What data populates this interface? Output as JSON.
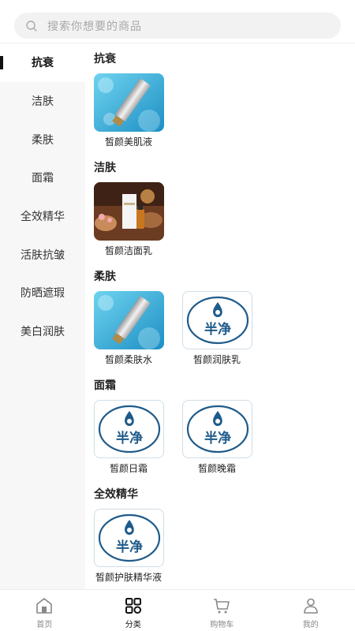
{
  "search": {
    "placeholder": "搜索你想要的商品"
  },
  "sidebar": {
    "items": [
      {
        "label": "抗衰",
        "active": true
      },
      {
        "label": "洁肤",
        "active": false
      },
      {
        "label": "柔肤",
        "active": false
      },
      {
        "label": "面霜",
        "active": false
      },
      {
        "label": "全效精华",
        "active": false
      },
      {
        "label": "活肤抗皱",
        "active": false
      },
      {
        "label": "防晒遮瑕",
        "active": false
      },
      {
        "label": "美白润肤",
        "active": false
      }
    ]
  },
  "sections": [
    {
      "title": "抗衰",
      "products": [
        {
          "name": "皙颜美肌液",
          "image": "tube-water"
        }
      ]
    },
    {
      "title": "洁肤",
      "products": [
        {
          "name": "皙颜洁面乳",
          "image": "spa-bottle"
        }
      ]
    },
    {
      "title": "柔肤",
      "products": [
        {
          "name": "皙颜柔肤水",
          "image": "tube-water"
        },
        {
          "name": "皙颜润肤乳",
          "image": "brand-logo"
        }
      ]
    },
    {
      "title": "面霜",
      "products": [
        {
          "name": "皙颜日霜",
          "image": "brand-logo"
        },
        {
          "name": "皙颜晚霜",
          "image": "brand-logo"
        }
      ]
    },
    {
      "title": "全效精华",
      "products": [
        {
          "name": "皙颜护肤精华液",
          "image": "brand-logo"
        }
      ]
    }
  ],
  "brand": {
    "logo_text": "半净",
    "color": "#1f5b8a"
  },
  "tabbar": {
    "items": [
      {
        "label": "首页",
        "icon": "home-icon",
        "active": false
      },
      {
        "label": "分类",
        "icon": "category-icon",
        "active": true
      },
      {
        "label": "购物车",
        "icon": "cart-icon",
        "active": false
      },
      {
        "label": "我的",
        "icon": "profile-icon",
        "active": false
      }
    ]
  }
}
